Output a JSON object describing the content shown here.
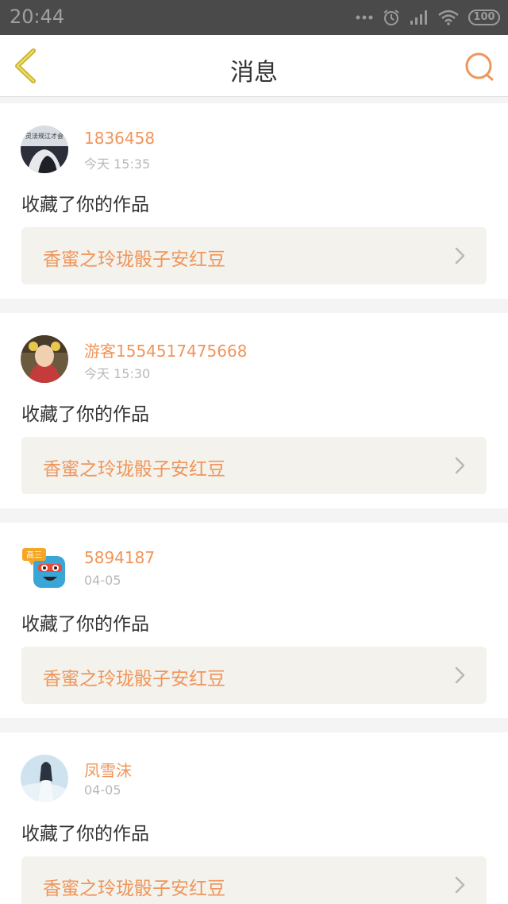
{
  "status_bar": {
    "time": "20:44",
    "battery": "100"
  },
  "nav": {
    "title": "消息"
  },
  "messages": [
    {
      "username": "1836458",
      "time": "今天 15:35",
      "action": "收藏了你的作品",
      "work_title": "香蜜之玲珑骰子安红豆",
      "avatar_text": "灵法规江才会"
    },
    {
      "username": "游客1554517475668",
      "time": "今天 15:30",
      "action": "收藏了你的作品",
      "work_title": "香蜜之玲珑骰子安红豆"
    },
    {
      "username": "5894187",
      "time": "04-05",
      "action": "收藏了你的作品",
      "work_title": "香蜜之玲珑骰子安红豆",
      "avatar_text": "高三"
    },
    {
      "username": "凤雪沫",
      "time": "04-05",
      "action": "收藏了你的作品",
      "work_title": "香蜜之玲珑骰子安红豆"
    }
  ],
  "colors": {
    "accent": "#f0955a",
    "back_icon": "#c9b52e",
    "status_bar_bg": "#4a4a4a"
  }
}
